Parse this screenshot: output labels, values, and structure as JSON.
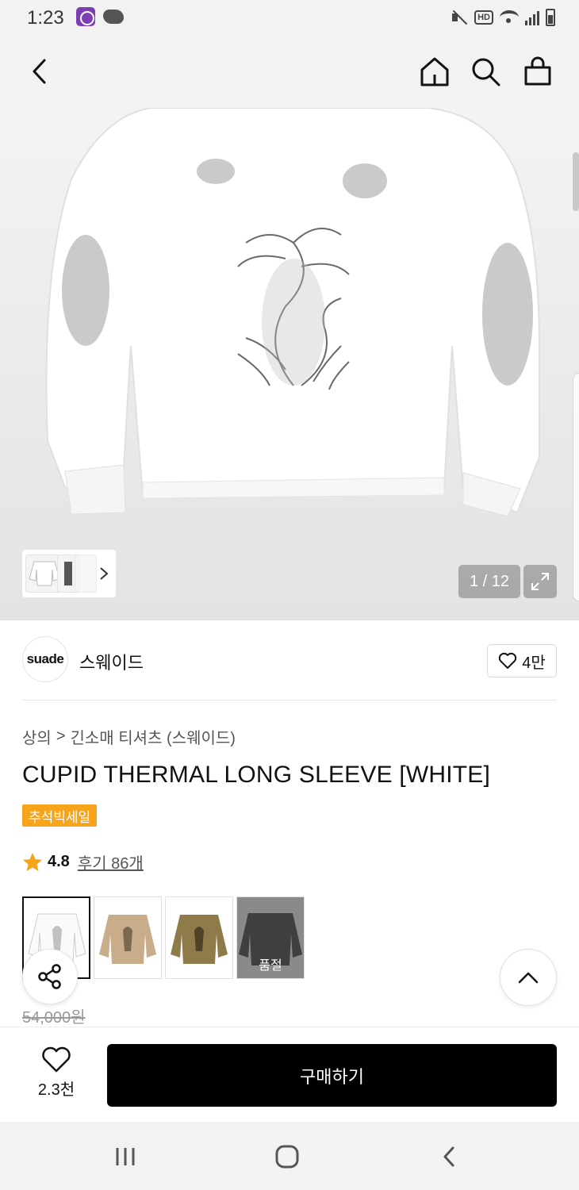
{
  "status_bar": {
    "time": "1:23",
    "hd_label": "HD"
  },
  "hero": {
    "page_counter": "1 / 12"
  },
  "brand": {
    "logo_text": "suade",
    "name": "스웨이드",
    "like_count": "4만"
  },
  "breadcrumb": {
    "category": "상의",
    "separator": ">",
    "subcategory": "긴소매 티셔츠 (스웨이드)"
  },
  "product": {
    "title": "CUPID THERMAL LONG SLEEVE [WHITE]",
    "badge": "추석빅세일",
    "rating": "4.8",
    "reviews": "후기 86개",
    "original_price": "54,000원"
  },
  "options": [
    {
      "color": "white",
      "selected": true,
      "soldout_label": ""
    },
    {
      "color": "beige",
      "selected": false,
      "soldout_label": ""
    },
    {
      "color": "khaki",
      "selected": false,
      "soldout_label": ""
    },
    {
      "color": "black",
      "selected": false,
      "soldout_label": "품절"
    }
  ],
  "purchase": {
    "wish_count": "2.3천",
    "buy_label": "구매하기"
  },
  "colors": {
    "accent_badge": "#f7a41d",
    "star": "#f7a41d",
    "buy_button": "#000000"
  },
  "icons": [
    "back-icon",
    "home-icon",
    "search-icon",
    "bag-icon",
    "chevron-right-icon",
    "expand-icon",
    "heart-icon",
    "star-icon",
    "share-icon",
    "chevron-up-icon"
  ]
}
